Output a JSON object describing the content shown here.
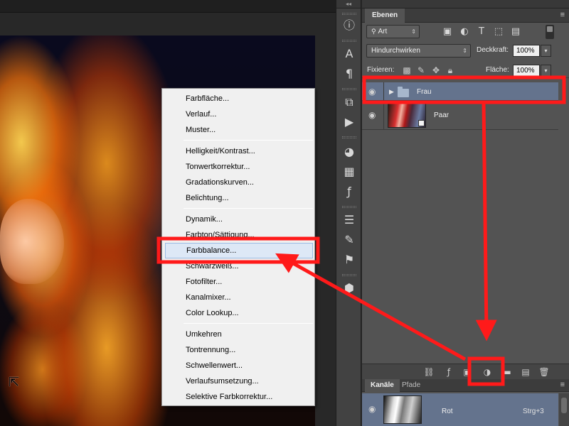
{
  "context_menu": {
    "items": [
      "Farbfläche...",
      "Verlauf...",
      "Muster...",
      "Helligkeit/Kontrast...",
      "Tonwertkorrektur...",
      "Gradationskurven...",
      "Belichtung...",
      "Dynamik...",
      "Farbton/Sättigung...",
      "Farbbalance...",
      "Schwarzweiß...",
      "Fotofilter...",
      "Kanalmixer...",
      "Color Lookup...",
      "Umkehren",
      "Tontrennung...",
      "Schwellenwert...",
      "Verlaufsumsetzung...",
      "Selektive Farbkorrektur..."
    ],
    "highlighted": "Farbbalance..."
  },
  "layers_panel": {
    "tab_label": "Ebenen",
    "filter_kind": "Art",
    "blend_mode": "Hindurchwirken",
    "opacity_label": "Deckkraft:",
    "opacity_value": "100%",
    "lock_label": "Fixieren:",
    "fill_label": "Fläche:",
    "fill_value": "100%",
    "layers": [
      {
        "name": "Frau",
        "type": "group",
        "selected": true
      },
      {
        "name": "Paar",
        "type": "smart-object",
        "selected": false
      }
    ]
  },
  "channels_panel": {
    "tabs": [
      "Kanäle",
      "Pfade"
    ],
    "active_tab": "Kanäle",
    "channel": {
      "name": "Rot",
      "shortcut": "Strg+3"
    }
  },
  "icons": {
    "panel_collapse": "double-chevron-icon",
    "panel_menu": "panel-menu-icon",
    "visibility": "eye-icon"
  },
  "colors": {
    "annotation_red": "#ff1a1a",
    "selection_blue": "#64738d",
    "panel_gray": "#535353"
  }
}
